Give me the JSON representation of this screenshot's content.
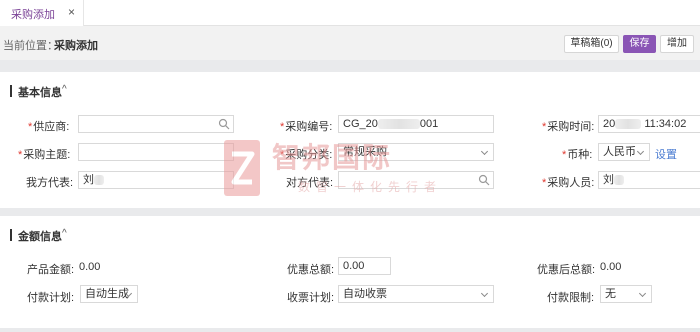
{
  "tabs": [
    {
      "label": "采购添加",
      "close": "×"
    }
  ],
  "breadcrumb": {
    "prefix": "当前位置：",
    "current": "采购添加"
  },
  "toolbar": {
    "draft_label": "草稿箱(0)",
    "save_label": "保存",
    "add_label": "增加"
  },
  "basic_info": {
    "title": "基本信息",
    "caret": "^",
    "supplier": {
      "label": "供应商:",
      "required": "*",
      "value": ""
    },
    "purchase_no": {
      "label": "采购编号:",
      "required": "*",
      "value_prefix": "CG_20",
      "value_suffix": "001"
    },
    "purchase_time": {
      "label": "采购时间:",
      "required": "*",
      "value_prefix": "20",
      "value_suffix": "11:34:02"
    },
    "subject": {
      "label": "采购主题:",
      "required": "*",
      "value": ""
    },
    "category": {
      "label": "采购分类:",
      "required": "*",
      "value": "常规采购"
    },
    "currency": {
      "label": "币种:",
      "required": "*",
      "value": "人民币",
      "settings_link": "设置"
    },
    "our_rep": {
      "label": "我方代表:",
      "value_prefix": "刘"
    },
    "their_rep": {
      "label": "对方代表:",
      "value": ""
    },
    "purchaser": {
      "label": "采购人员:",
      "required": "*",
      "value_prefix": "刘"
    }
  },
  "amount_info": {
    "title": "金额信息",
    "caret": "^",
    "product_amount": {
      "label": "产品金额:",
      "value": "0.00"
    },
    "discount_total": {
      "label": "优惠总额:",
      "value": "0.00"
    },
    "after_discount": {
      "label": "优惠后总额:",
      "value": "0.00"
    },
    "payment_plan": {
      "label": "付款计划:",
      "value": "自动生成"
    },
    "receipt_plan": {
      "label": "收票计划:",
      "value": "自动收票"
    },
    "payment_limit": {
      "label": "付款限制:",
      "value": "无"
    }
  },
  "watermark": {
    "brand": "智邦国际",
    "tagline": "数智一体化先行者"
  },
  "colors": {
    "accent": "#8a55b5",
    "tab_text": "#7b4397",
    "required": "#e0382f",
    "link": "#4a7bd1"
  }
}
